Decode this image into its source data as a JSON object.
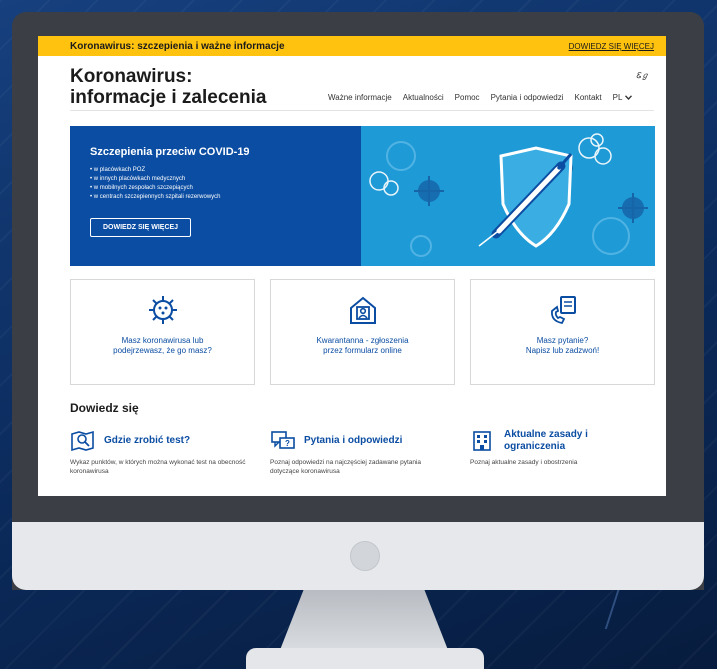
{
  "topbar": {
    "alert_text": "Koronawirus: szczepienia i ważne informacje",
    "more_link": "DOWIEDZ SIĘ WIĘCEJ",
    "color": "#ffc20e"
  },
  "header": {
    "title_line1": "Koronawirus:",
    "title_line2": "informacje i zalecenia",
    "a11y_icon": "accessibility-icon"
  },
  "nav": {
    "items": [
      "Ważne informacje",
      "Aktualności",
      "Pomoc",
      "Pytania i odpowiedzi",
      "Kontakt"
    ],
    "language": "PL"
  },
  "hero": {
    "title": "Szczepienia przeciw COVID-19",
    "list": [
      "w placówkach POZ",
      "w innych placówkach medycznych",
      "w mobilnych zespołach szczepiących",
      "w centrach szczepiennych szpitali rezerwowych"
    ],
    "button": "DOWIEDZ SIĘ WIĘCEJ",
    "colors": {
      "dark": "#0b4da2",
      "light": "#1e9ad6"
    }
  },
  "cards": [
    {
      "line1": "Masz koronawirusa lub",
      "line2": "podejrzewasz, że go masz?",
      "icon": "virus-icon"
    },
    {
      "line1": "Kwarantanna - zgłoszenia",
      "line2": "przez formularz online",
      "icon": "house-person-icon"
    },
    {
      "line1": "Masz pytanie?",
      "line2": "Napisz lub zadzwoń!",
      "icon": "phone-chat-icon"
    }
  ],
  "learn": {
    "title": "Dowiedz się",
    "items": [
      {
        "title_line1": "Gdzie zrobić test?",
        "title_line2": "",
        "desc": "Wykaz punktów, w których można wykonać test na obecność koronawirusa",
        "icon": "map-test-icon"
      },
      {
        "title_line1": "Pytania i odpowiedzi",
        "title_line2": "",
        "desc": "Poznaj odpowiedzi na najczęściej zadawane pytania dotyczące koronawirusa",
        "icon": "chat-bubbles-icon"
      },
      {
        "title_line1": "Aktualne zasady i",
        "title_line2": "ograniczenia",
        "desc": "Poznaj aktualne zasady i obostrzenia",
        "icon": "building-icon"
      }
    ]
  }
}
